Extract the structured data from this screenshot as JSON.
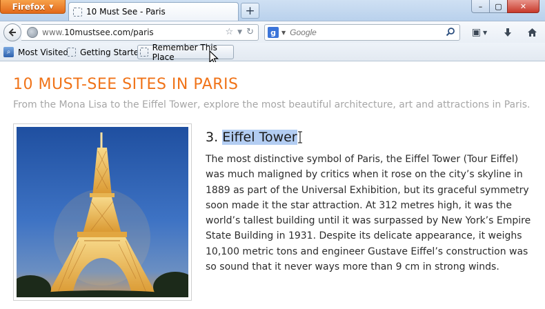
{
  "browser": {
    "app_button_label": "Firefox",
    "tab_title": "10 Must See - Paris",
    "new_tab_label": "+",
    "url_prefix": "www.",
    "url_domain": "10mustsee.com/paris",
    "search_placeholder": "Google",
    "search_engine_letter": "g",
    "window_controls": {
      "minimize": "–",
      "maximize": "▢",
      "close": "✕"
    },
    "icons": {
      "back": "back-arrow-icon",
      "site_identity": "globe-icon",
      "bookmark_star": "star-icon",
      "history_dropdown": "dropdown-icon",
      "reload": "reload-icon",
      "search": "magnifier-icon",
      "bookmarks_menu": "bookmarks-menu-icon",
      "downloads": "download-icon",
      "home": "home-icon"
    }
  },
  "bookmarks": [
    {
      "label": "Most Visited"
    },
    {
      "label": "Getting Started"
    },
    {
      "label": "Remember This Place"
    }
  ],
  "page": {
    "title": "10 MUST-SEE SITES IN PARIS",
    "subtitle": "From the Mona Lisa to the Eiffel Tower, explore the most beautiful architecture, art and attractions in Paris.",
    "entry": {
      "number": "3.",
      "name": "Eiffel Tower",
      "body": "The most distinctive symbol of Paris, the Eiffel Tower (Tour Eiffel) was much maligned by critics when it rose on the city’s skyline in 1889 as part of the Universal Exhibition, but its graceful symmetry soon made it the star attraction. At 312 metres high, it was the world’s tallest building until it was surpassed by New York’s Empire State Building in 1931. Despite its delicate appearance, it weighs 10,100 metric tons and engineer Gustave Eiffel’s construction was so sound that it never ways more than 9 cm in strong winds."
    }
  },
  "colors": {
    "title_orange": "#f07318",
    "subtitle_gray": "#a6a6a6",
    "selection_blue": "#b3cdf2",
    "firefox_orange": "#e2681a"
  }
}
